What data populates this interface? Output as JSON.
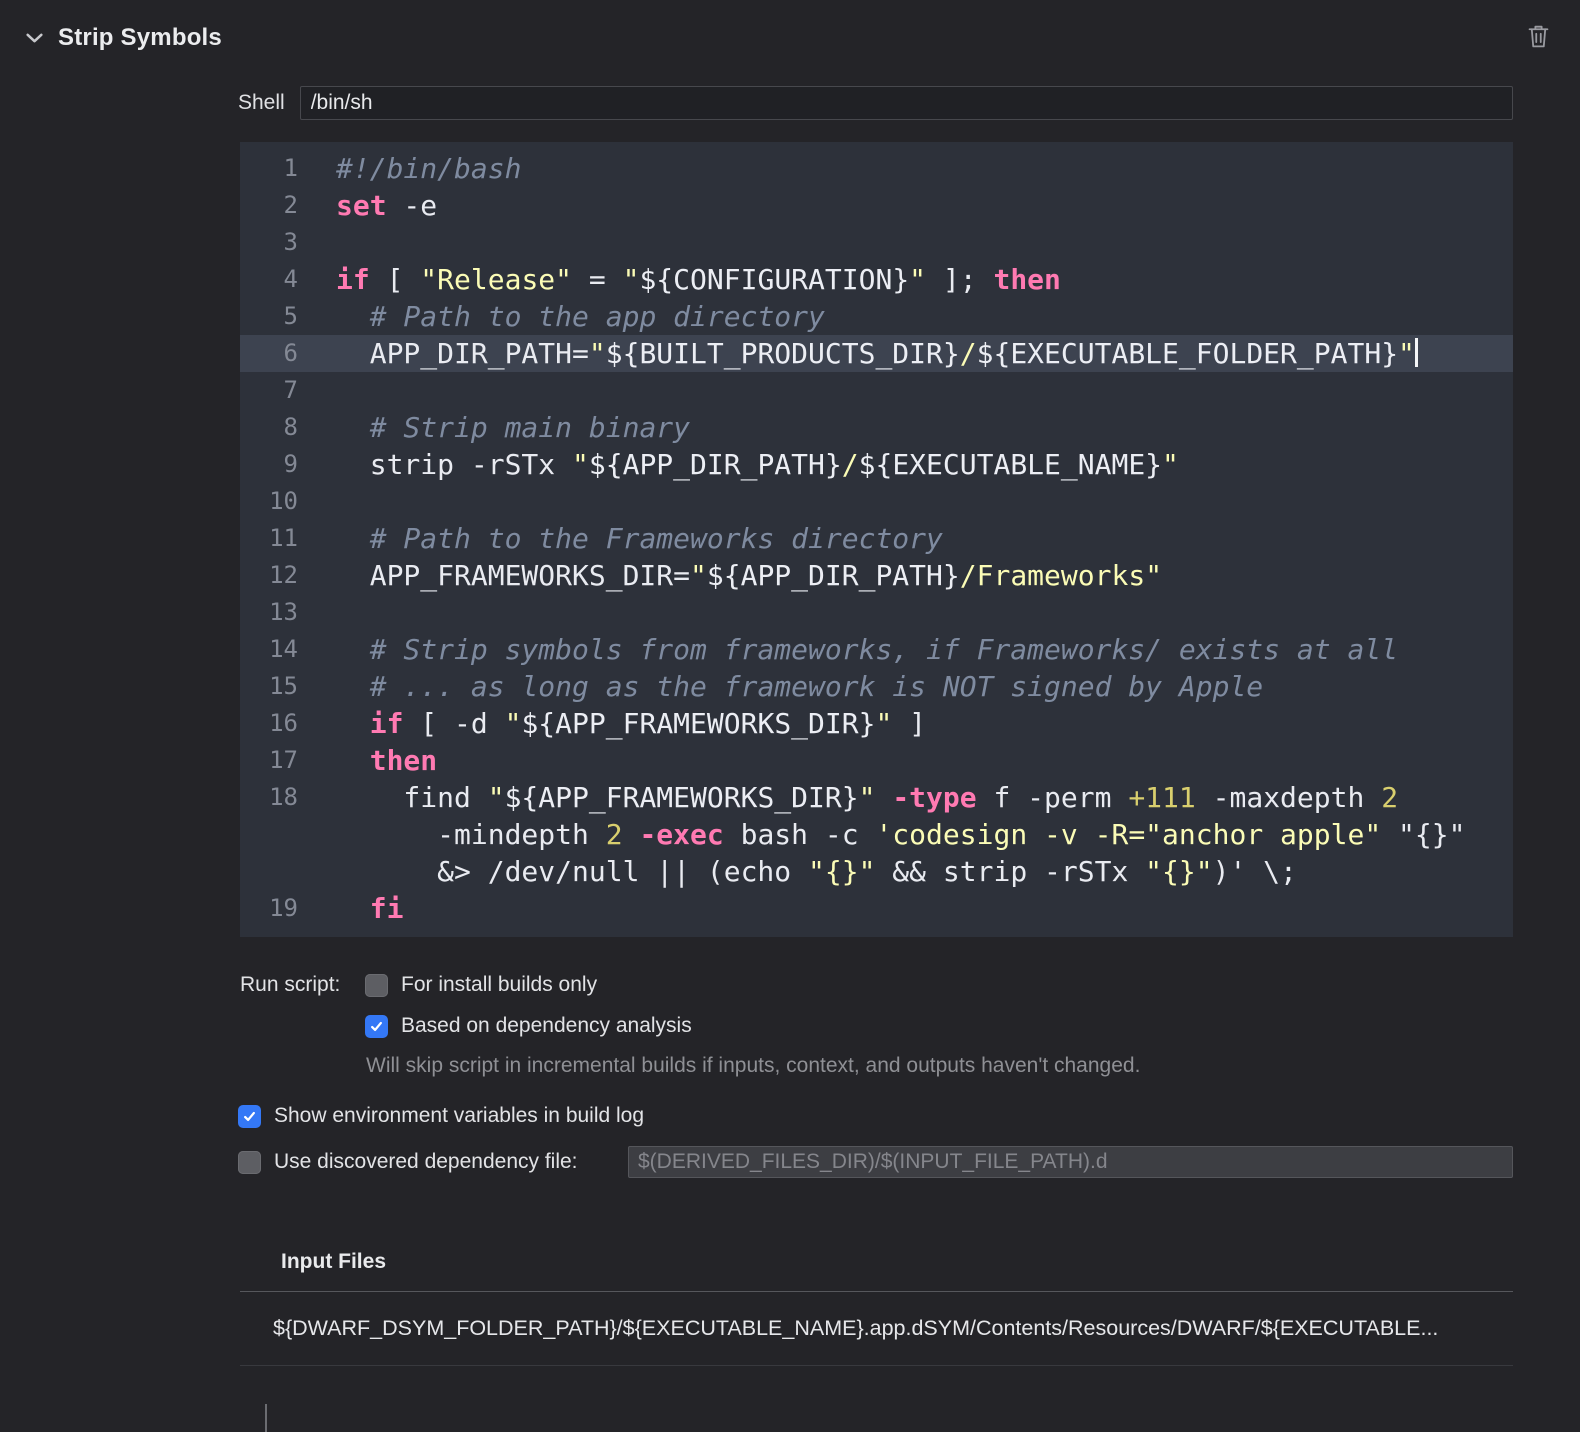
{
  "header": {
    "title": "Strip Symbols"
  },
  "shell": {
    "label": "Shell",
    "value": "/bin/sh"
  },
  "editor": {
    "language": "bash",
    "current_line": 6,
    "lines": [
      {
        "n": "1",
        "segs": [
          {
            "t": "#!/bin/bash",
            "c": "comment"
          }
        ]
      },
      {
        "n": "2",
        "segs": [
          {
            "t": "set",
            "c": "keyword"
          },
          {
            "t": " -e",
            "c": "plain"
          }
        ]
      },
      {
        "n": "3",
        "segs": []
      },
      {
        "n": "4",
        "segs": [
          {
            "t": "if",
            "c": "keyword"
          },
          {
            "t": " [ ",
            "c": "plain"
          },
          {
            "t": "\"Release\"",
            "c": "string"
          },
          {
            "t": " = ",
            "c": "plain"
          },
          {
            "t": "\"",
            "c": "string"
          },
          {
            "t": "${CONFIGURATION}",
            "c": "var"
          },
          {
            "t": "\"",
            "c": "string"
          },
          {
            "t": " ]; ",
            "c": "plain"
          },
          {
            "t": "then",
            "c": "keyword"
          }
        ]
      },
      {
        "n": "5",
        "segs": [
          {
            "t": "  ",
            "c": "plain"
          },
          {
            "t": "# Path to the app directory",
            "c": "comment"
          }
        ]
      },
      {
        "n": "6",
        "hl": true,
        "cursor": true,
        "segs": [
          {
            "t": "  APP_DIR_PATH=",
            "c": "plain"
          },
          {
            "t": "\"",
            "c": "string"
          },
          {
            "t": "${BUILT_PRODUCTS_DIR}",
            "c": "var"
          },
          {
            "t": "/",
            "c": "string"
          },
          {
            "t": "${EXECUTABLE_FOLDER_PATH}",
            "c": "var"
          },
          {
            "t": "\"",
            "c": "string"
          }
        ]
      },
      {
        "n": "7",
        "segs": []
      },
      {
        "n": "8",
        "segs": [
          {
            "t": "  ",
            "c": "plain"
          },
          {
            "t": "# Strip main binary",
            "c": "comment"
          }
        ]
      },
      {
        "n": "9",
        "segs": [
          {
            "t": "  strip -rSTx ",
            "c": "plain"
          },
          {
            "t": "\"",
            "c": "string"
          },
          {
            "t": "${APP_DIR_PATH}",
            "c": "var"
          },
          {
            "t": "/",
            "c": "string"
          },
          {
            "t": "${EXECUTABLE_NAME}",
            "c": "var"
          },
          {
            "t": "\"",
            "c": "string"
          }
        ]
      },
      {
        "n": "10",
        "segs": []
      },
      {
        "n": "11",
        "segs": [
          {
            "t": "  ",
            "c": "plain"
          },
          {
            "t": "# Path to the Frameworks directory",
            "c": "comment"
          }
        ]
      },
      {
        "n": "12",
        "segs": [
          {
            "t": "  APP_FRAMEWORKS_DIR=",
            "c": "plain"
          },
          {
            "t": "\"",
            "c": "string"
          },
          {
            "t": "${APP_DIR_PATH}",
            "c": "var"
          },
          {
            "t": "/Frameworks",
            "c": "string"
          },
          {
            "t": "\"",
            "c": "string"
          }
        ]
      },
      {
        "n": "13",
        "segs": []
      },
      {
        "n": "14",
        "segs": [
          {
            "t": "  ",
            "c": "plain"
          },
          {
            "t": "# Strip symbols from frameworks, if Frameworks/ exists at all",
            "c": "comment"
          }
        ]
      },
      {
        "n": "15",
        "segs": [
          {
            "t": "  ",
            "c": "plain"
          },
          {
            "t": "# ... as long as the framework is NOT signed by Apple",
            "c": "comment"
          }
        ]
      },
      {
        "n": "16",
        "segs": [
          {
            "t": "  ",
            "c": "plain"
          },
          {
            "t": "if",
            "c": "keyword"
          },
          {
            "t": " [ -d ",
            "c": "plain"
          },
          {
            "t": "\"",
            "c": "string"
          },
          {
            "t": "${APP_FRAMEWORKS_DIR}",
            "c": "var"
          },
          {
            "t": "\"",
            "c": "string"
          },
          {
            "t": " ]",
            "c": "plain"
          }
        ]
      },
      {
        "n": "17",
        "segs": [
          {
            "t": "  ",
            "c": "plain"
          },
          {
            "t": "then",
            "c": "keyword"
          }
        ]
      },
      {
        "n": "18",
        "segs": [
          {
            "t": "    find ",
            "c": "plain"
          },
          {
            "t": "\"",
            "c": "string"
          },
          {
            "t": "${APP_FRAMEWORKS_DIR}",
            "c": "var"
          },
          {
            "t": "\"",
            "c": "string"
          },
          {
            "t": " ",
            "c": "plain"
          },
          {
            "t": "-type",
            "c": "keyword"
          },
          {
            "t": " f -perm ",
            "c": "plain"
          },
          {
            "t": "+111",
            "c": "number"
          },
          {
            "t": " -maxdepth ",
            "c": "plain"
          },
          {
            "t": "2",
            "c": "number"
          }
        ]
      },
      {
        "n": "",
        "segs": [
          {
            "t": "      -mindepth ",
            "c": "plain"
          },
          {
            "t": "2",
            "c": "number"
          },
          {
            "t": " ",
            "c": "plain"
          },
          {
            "t": "-exec",
            "c": "keyword"
          },
          {
            "t": " bash -c ",
            "c": "plain"
          },
          {
            "t": "'codesign -v -R=\"anchor apple\"",
            "c": "string"
          },
          {
            "t": " \"{}\"",
            "c": "plain"
          }
        ]
      },
      {
        "n": "",
        "segs": [
          {
            "t": "      &> /dev/null || (echo ",
            "c": "plain"
          },
          {
            "t": "\"{}\"",
            "c": "string"
          },
          {
            "t": " && strip -rSTx ",
            "c": "plain"
          },
          {
            "t": "\"{}\"",
            "c": "string"
          },
          {
            "t": ")' \\;",
            "c": "plain"
          }
        ]
      },
      {
        "n": "19",
        "segs": [
          {
            "t": "  ",
            "c": "plain"
          },
          {
            "t": "fi",
            "c": "keyword"
          }
        ]
      }
    ]
  },
  "run_script": {
    "label": "Run script:",
    "options": [
      {
        "label": "For install builds only",
        "checked": false
      },
      {
        "label": "Based on dependency analysis",
        "checked": true
      }
    ],
    "note": "Will skip script in incremental builds if inputs, context, and outputs haven't changed."
  },
  "env_checkbox": {
    "label": "Show environment variables in build log",
    "checked": true
  },
  "dependency_file": {
    "label": "Use discovered dependency file:",
    "checked": false,
    "value": "$(DERIVED_FILES_DIR)/$(INPUT_FILE_PATH).d"
  },
  "input_files": {
    "title": "Input Files",
    "rows": [
      "${DWARF_DSYM_FOLDER_PATH}/${EXECUTABLE_NAME}.app.dSYM/Contents/Resources/DWARF/${EXECUTABLE..."
    ]
  },
  "colors": {
    "accent": "#3478f6",
    "keyword": "#ff7ab2",
    "string": "#fbfcb6",
    "comment": "#7f8ba0",
    "number": "#d9cf6e",
    "editor_bg": "#2d313a",
    "current_line_bg": "#3d4350"
  }
}
